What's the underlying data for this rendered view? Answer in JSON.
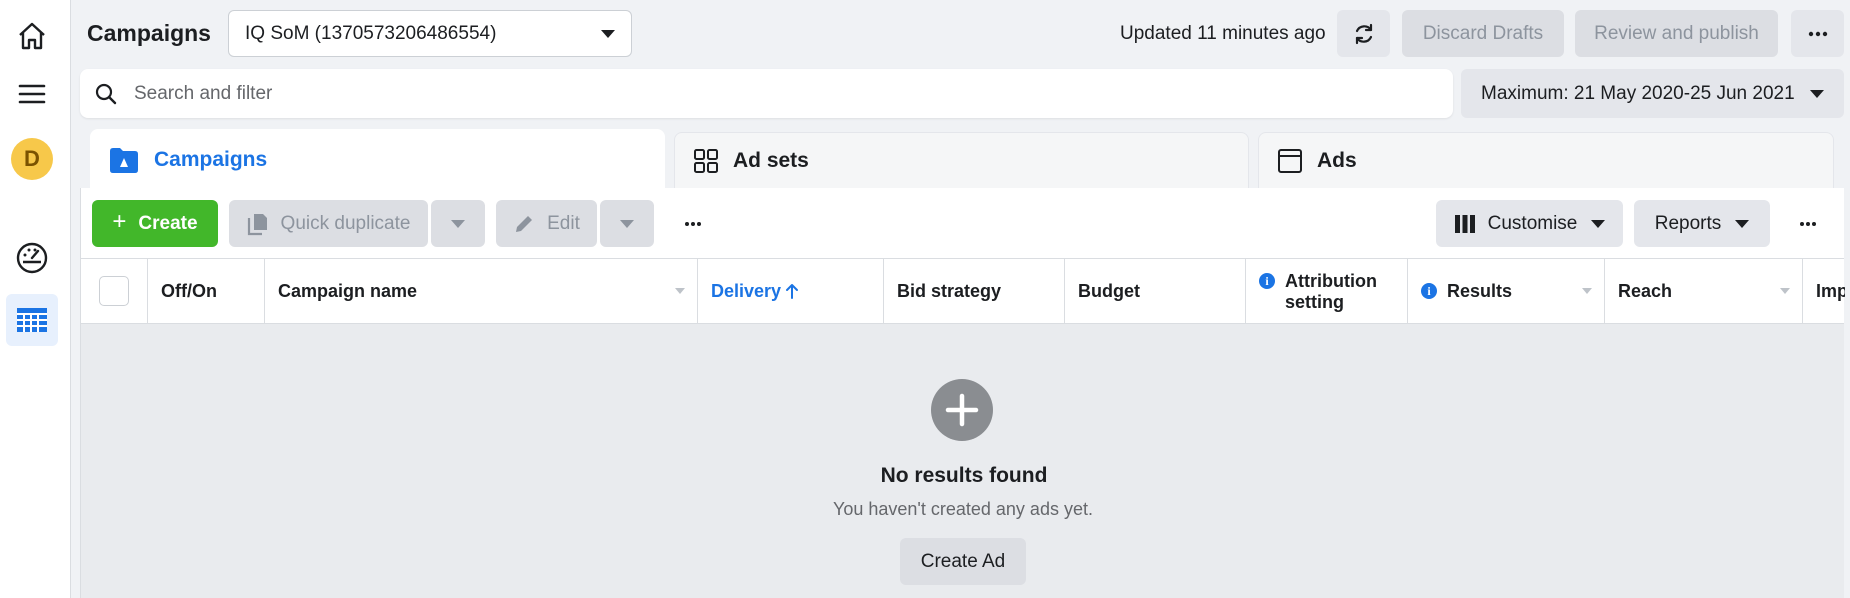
{
  "header": {
    "title": "Campaigns",
    "account": "IQ SoM (1370573206486554)",
    "updated": "Updated 11 minutes ago",
    "discard_label": "Discard Drafts",
    "review_label": "Review and publish"
  },
  "search": {
    "placeholder": "Search and filter",
    "value": ""
  },
  "date_range": "Maximum: 21 May 2020-25 Jun 2021",
  "tabs": [
    {
      "label": "Campaigns",
      "active": true
    },
    {
      "label": "Ad sets",
      "active": false
    },
    {
      "label": "Ads",
      "active": false
    }
  ],
  "toolbar": {
    "create_label": "Create",
    "duplicate_label": "Quick duplicate",
    "edit_label": "Edit",
    "customise_label": "Customise",
    "reports_label": "Reports"
  },
  "table": {
    "columns": [
      "Off/On",
      "Campaign name",
      "Delivery",
      "Bid strategy",
      "Budget",
      "Attribution setting",
      "Results",
      "Reach",
      "Imp"
    ],
    "sorted_column": "Delivery",
    "sort_direction": "ascending"
  },
  "empty_state": {
    "title": "No results found",
    "subtitle": "You haven't created any ads yet.",
    "button_label": "Create Ad"
  },
  "colors": {
    "accent_blue": "#1b74e4",
    "create_green": "#42b72a",
    "avatar_yellow": "#f7c84a"
  },
  "rail": {
    "avatar_initial": "D",
    "icons": [
      "home-icon",
      "menu-icon",
      "avatar",
      "dashboard-gauge-icon",
      "table-grid-icon"
    ]
  }
}
